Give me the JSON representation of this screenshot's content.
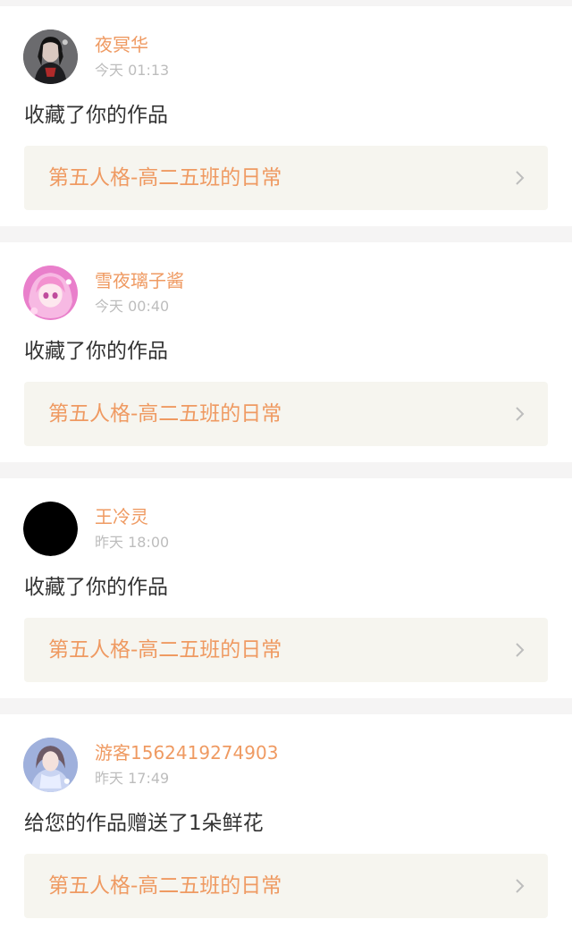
{
  "colors": {
    "accent": "#ef9a62",
    "timestamp": "#bdbdbd",
    "body_text": "#333333",
    "card_bg": "#ffffff",
    "link_bg": "#f6f5ef",
    "page_bg": "#f5f4f4"
  },
  "notifications": [
    {
      "username": "夜冥华",
      "time": "今天 01:13",
      "action": "收藏了你的作品",
      "work_title": "第五人格-高二五班的日常",
      "avatar_icon": "avatar-dark-character-icon",
      "chevron_icon": "chevron-right-icon"
    },
    {
      "username": "雪夜璃子酱",
      "time": "今天 00:40",
      "action": "收藏了你的作品",
      "work_title": "第五人格-高二五班的日常",
      "avatar_icon": "avatar-pink-anime-icon",
      "chevron_icon": "chevron-right-icon"
    },
    {
      "username": "王冷灵",
      "time": "昨天 18:00",
      "action": "收藏了你的作品",
      "work_title": "第五人格-高二五班的日常",
      "avatar_icon": "avatar-black-icon",
      "chevron_icon": "chevron-right-icon"
    },
    {
      "username": "游客1562419274903",
      "time": "昨天 17:49",
      "action": "给您的作品赠送了1朵鲜花",
      "work_title": "第五人格-高二五班的日常",
      "avatar_icon": "avatar-blue-doll-icon",
      "chevron_icon": "chevron-right-icon"
    }
  ]
}
